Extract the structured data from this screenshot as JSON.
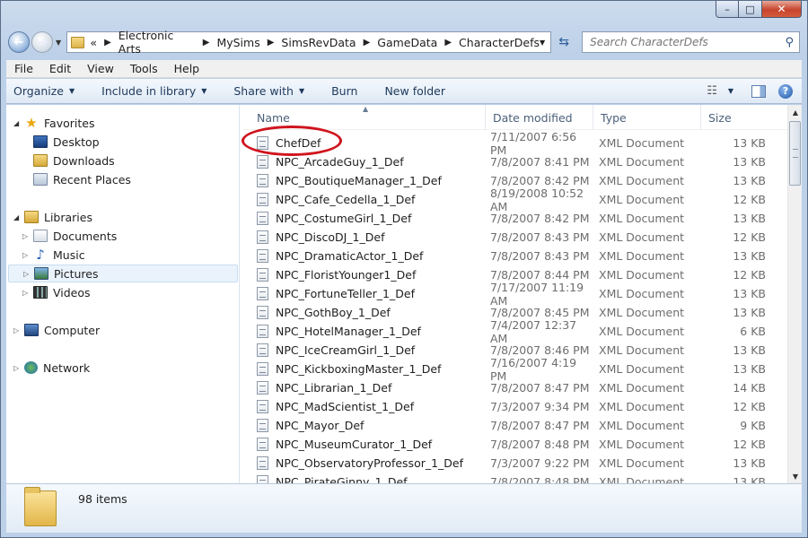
{
  "window": {
    "caption": {
      "minimize": "–",
      "maximize": "□",
      "close": "✕"
    }
  },
  "address": {
    "breadcrumbs": [
      "Electronic Arts",
      "MySims",
      "SimsRevData",
      "GameData",
      "CharacterDefs"
    ],
    "overflow": "«"
  },
  "search": {
    "placeholder": "Search CharacterDefs"
  },
  "menu": [
    "File",
    "Edit",
    "View",
    "Tools",
    "Help"
  ],
  "commands": {
    "organize": "Organize",
    "include_in_library": "Include in library",
    "share_with": "Share with",
    "burn": "Burn",
    "new_folder": "New folder"
  },
  "nav": {
    "favorites": "Favorites",
    "desktop": "Desktop",
    "downloads": "Downloads",
    "recent_places": "Recent Places",
    "libraries": "Libraries",
    "documents": "Documents",
    "music": "Music",
    "pictures": "Pictures",
    "videos": "Videos",
    "computer": "Computer",
    "network": "Network"
  },
  "columns": {
    "name": "Name",
    "date": "Date modified",
    "type": "Type",
    "size": "Size"
  },
  "files": [
    {
      "name": "ChefDef",
      "date": "7/11/2007 6:56 PM",
      "type": "XML Document",
      "size": "13 KB"
    },
    {
      "name": "NPC_ArcadeGuy_1_Def",
      "date": "7/8/2007 8:41 PM",
      "type": "XML Document",
      "size": "13 KB"
    },
    {
      "name": "NPC_BoutiqueManager_1_Def",
      "date": "7/8/2007 8:42 PM",
      "type": "XML Document",
      "size": "13 KB"
    },
    {
      "name": "NPC_Cafe_Cedella_1_Def",
      "date": "8/19/2008 10:52 AM",
      "type": "XML Document",
      "size": "12 KB"
    },
    {
      "name": "NPC_CostumeGirl_1_Def",
      "date": "7/8/2007 8:42 PM",
      "type": "XML Document",
      "size": "13 KB"
    },
    {
      "name": "NPC_DiscoDJ_1_Def",
      "date": "7/8/2007 8:43 PM",
      "type": "XML Document",
      "size": "12 KB"
    },
    {
      "name": "NPC_DramaticActor_1_Def",
      "date": "7/8/2007 8:43 PM",
      "type": "XML Document",
      "size": "13 KB"
    },
    {
      "name": "NPC_FloristYounger1_Def",
      "date": "7/8/2007 8:44 PM",
      "type": "XML Document",
      "size": "12 KB"
    },
    {
      "name": "NPC_FortuneTeller_1_Def",
      "date": "7/17/2007 11:19 AM",
      "type": "XML Document",
      "size": "13 KB"
    },
    {
      "name": "NPC_GothBoy_1_Def",
      "date": "7/8/2007 8:45 PM",
      "type": "XML Document",
      "size": "13 KB"
    },
    {
      "name": "NPC_HotelManager_1_Def",
      "date": "7/4/2007 12:37 AM",
      "type": "XML Document",
      "size": "6 KB"
    },
    {
      "name": "NPC_IceCreamGirl_1_Def",
      "date": "7/8/2007 8:46 PM",
      "type": "XML Document",
      "size": "13 KB"
    },
    {
      "name": "NPC_KickboxingMaster_1_Def",
      "date": "7/16/2007 4:19 PM",
      "type": "XML Document",
      "size": "13 KB"
    },
    {
      "name": "NPC_Librarian_1_Def",
      "date": "7/8/2007 8:47 PM",
      "type": "XML Document",
      "size": "14 KB"
    },
    {
      "name": "NPC_MadScientist_1_Def",
      "date": "7/3/2007 9:34 PM",
      "type": "XML Document",
      "size": "12 KB"
    },
    {
      "name": "NPC_Mayor_Def",
      "date": "7/8/2007 8:47 PM",
      "type": "XML Document",
      "size": "9 KB"
    },
    {
      "name": "NPC_MuseumCurator_1_Def",
      "date": "7/8/2007 8:48 PM",
      "type": "XML Document",
      "size": "12 KB"
    },
    {
      "name": "NPC_ObservatoryProfessor_1_Def",
      "date": "7/3/2007 9:22 PM",
      "type": "XML Document",
      "size": "13 KB"
    },
    {
      "name": "NPC_PirateGinny_1_Def",
      "date": "7/8/2007 8:48 PM",
      "type": "XML Document",
      "size": "13 KB"
    }
  ],
  "details": {
    "item_count": "98 items"
  },
  "colors": {
    "annotation": "#d0141e",
    "accent": "#1e395b"
  }
}
